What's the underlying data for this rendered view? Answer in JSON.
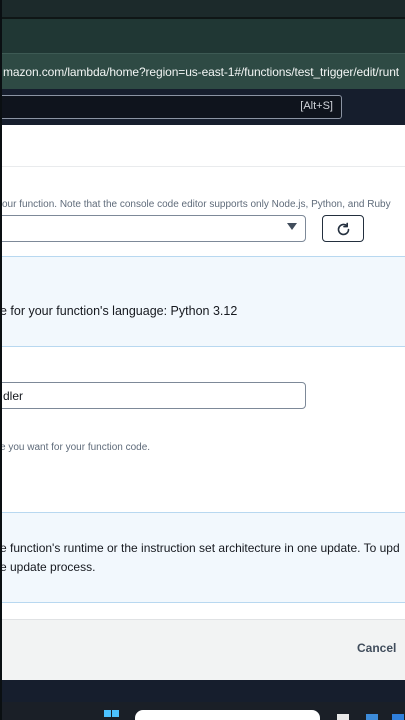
{
  "browser": {
    "url": "mazon.com/lambda/home?region=us-east-1#/functions/test_trigger/edit/runt"
  },
  "aws_nav": {
    "search_shortcut": "[Alt+S]"
  },
  "runtime_section": {
    "hint": "our function. Note that the console code editor supports only Node.js, Python, and Ruby",
    "selected_runtime": ""
  },
  "runtime_info": {
    "message": "e for your function's language: Python 3.12"
  },
  "handler": {
    "value": "dler",
    "hint": "e you want for your function code."
  },
  "architecture_info": {
    "line1": "e function's runtime or the instruction set architecture in one update. To upd",
    "line2": "e update process."
  },
  "footer": {
    "cancel_label": "Cancel"
  },
  "colors": {
    "aws_nav_bg": "#161e2d",
    "info_bg": "#f2f8fd",
    "info_border": "#b8d8f0",
    "url_bar_bg": "#2e4a44"
  }
}
